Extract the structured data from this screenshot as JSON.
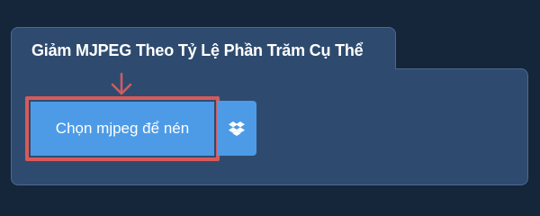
{
  "tab": {
    "title": "Giảm MJPEG Theo Tỷ Lệ Phần Trăm Cụ Thể"
  },
  "upload": {
    "choose_label": "Chọn mjpeg để nén",
    "dropbox_icon": "dropbox-icon",
    "pointer_icon": "down-arrow-icon"
  },
  "colors": {
    "background": "#15253a",
    "panel": "#2e4b6f",
    "button": "#4d9be6",
    "highlight": "#d65a5a"
  }
}
